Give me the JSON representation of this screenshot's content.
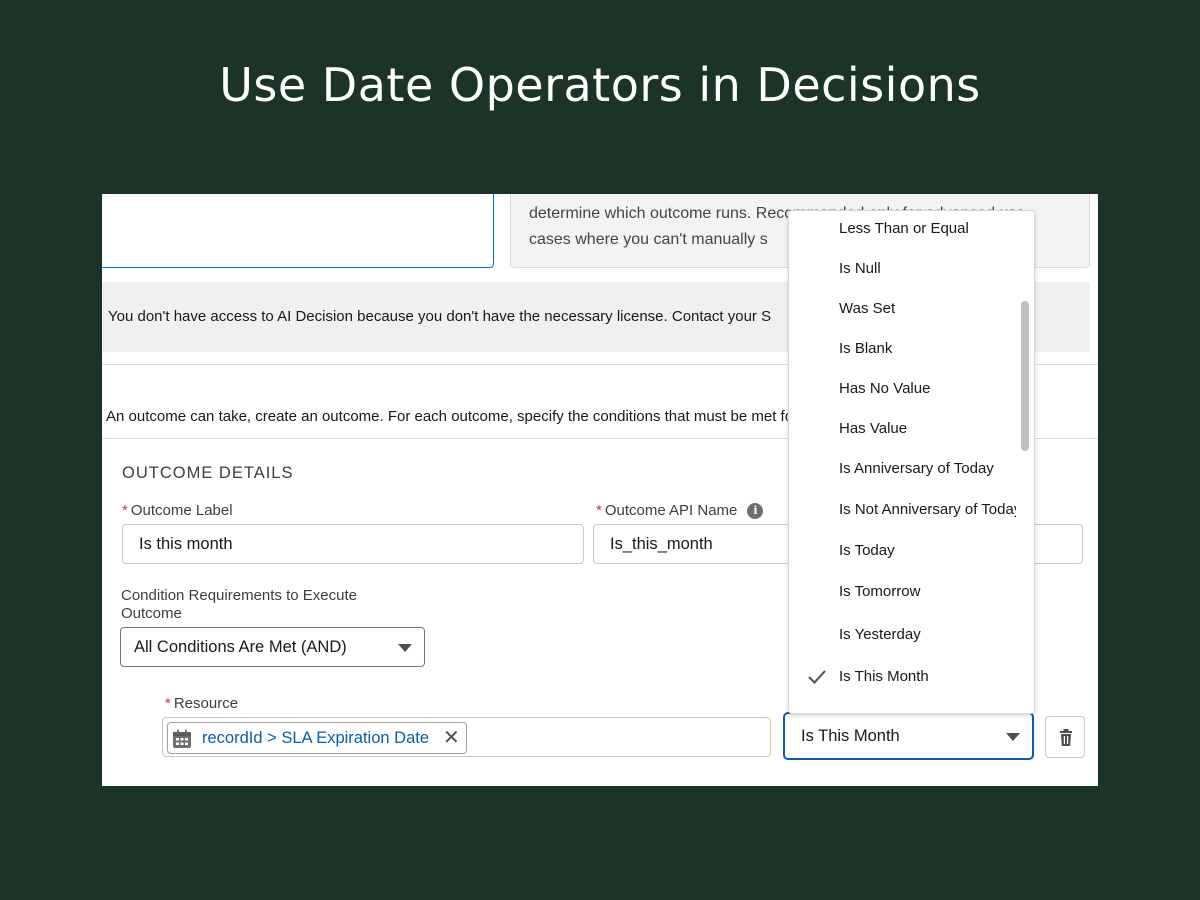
{
  "headline": "Use Date Operators in Decisions",
  "help_text": {
    "line1": "determine which outcome runs. Recommended only for advanced use",
    "line2": "cases where you can't manually s"
  },
  "license_notice": "You don't have access to AI Decision because you don't have the necessary license. Contact your S",
  "intro_text": "An outcome can take, create an outcome. For each outcome, specify the conditions that must be met fo",
  "outcome_details": {
    "section_title": "OUTCOME DETAILS",
    "outcome_label": {
      "required_mark": "*",
      "label": "Outcome Label",
      "value": "Is this month"
    },
    "outcome_api_name": {
      "required_mark": "*",
      "label": "Outcome API Name",
      "info_icon": "i",
      "value": "Is_this_month"
    },
    "condition_requirements": {
      "label_line1": "Condition Requirements to Execute",
      "label_line2": "Outcome",
      "selected": "All Conditions Are Met (AND)"
    },
    "resource": {
      "required_mark": "*",
      "label": "Resource",
      "pill_label": "recordId > SLA Expiration Date",
      "pill_icon": "calendar-icon",
      "remove_glyph": "✕"
    },
    "operator": {
      "selected": "Is This Month"
    }
  },
  "operator_dropdown": {
    "items": [
      "Less Than or Equal",
      "Is Null",
      "Was Set",
      "Is Blank",
      "Has No Value",
      "Has Value",
      "Is Anniversary of Today",
      "Is Not Anniversary of Today",
      "Is Today",
      "Is Tomorrow",
      "Is Yesterday",
      "Is This Month"
    ],
    "checked_item": "Is This Month"
  },
  "colors": {
    "background": "#1c3427",
    "accent_blue": "#0b5cab",
    "required_red": "#c23934"
  }
}
